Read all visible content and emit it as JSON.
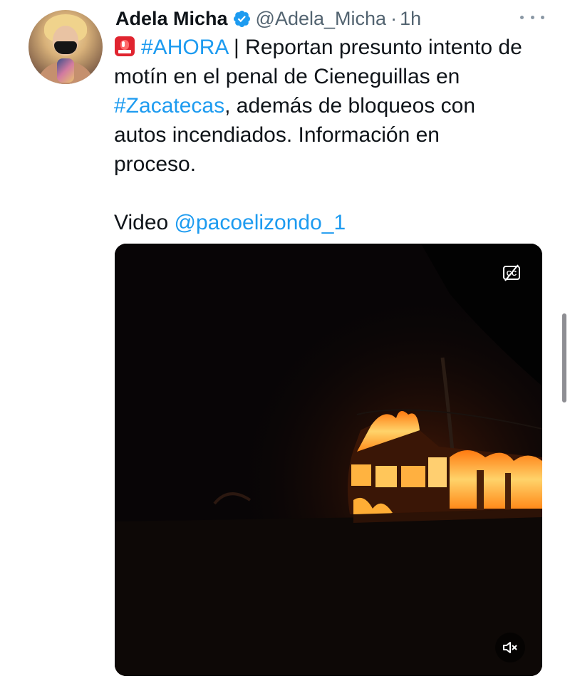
{
  "tweet": {
    "author_name": "Adela Micha",
    "handle": "@Adela_Micha",
    "separator": "·",
    "time": "1h",
    "avatar_icon": "profile-photo",
    "verified_icon": "verified-badge-icon",
    "text": {
      "siren_icon": "siren-emoji",
      "hashtag_ahora": "#AHORA",
      "line1_rest": " | Reportan presunto intento de",
      "line2": "motín en el penal de Cieneguillas en",
      "hashtag_zacatecas": "#Zacatecas",
      "line3_rest": ", además de bloqueos con",
      "line4": "autos incendiados. Información en",
      "line5": "proceso.",
      "video_label": "Video ",
      "mention": "@pacoelizondo_1"
    },
    "media": {
      "type": "video",
      "captions_icon": "closed-captions-icon",
      "mute_icon": "speaker-muted-icon"
    }
  },
  "colors": {
    "link": "#1d9bf0",
    "text": "#0f1419",
    "secondary": "#536471"
  }
}
